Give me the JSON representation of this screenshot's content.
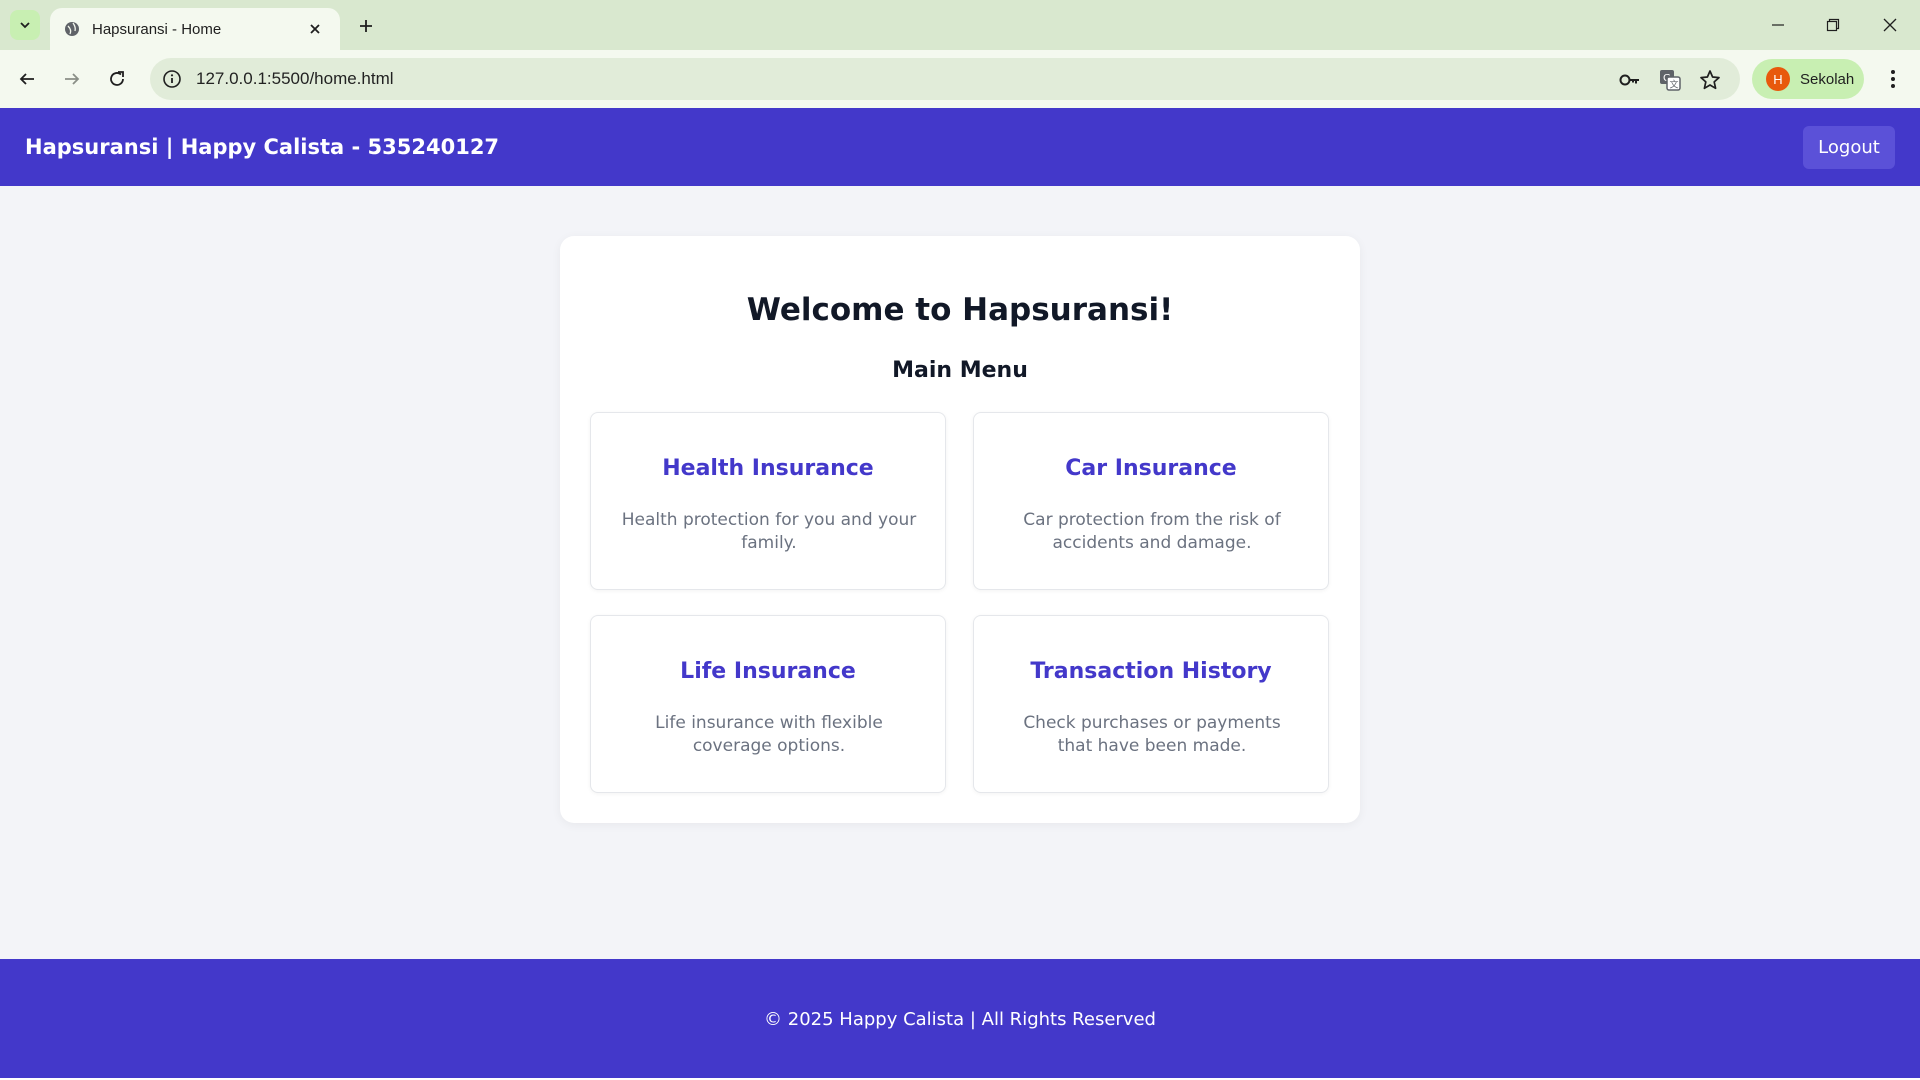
{
  "browser": {
    "tab_title": "Hapsuransi - Home",
    "url": "127.0.0.1:5500/home.html",
    "profile_initial": "H",
    "profile_name": "Sekolah",
    "icons": [
      "tab-list-icon",
      "globe-icon",
      "close-icon",
      "plus-icon",
      "minimize-icon",
      "restore-icon",
      "window-close-icon",
      "back-icon",
      "forward-icon",
      "reload-icon",
      "info-icon",
      "key-icon",
      "translate-icon",
      "star-icon",
      "kebab-menu-icon"
    ]
  },
  "header": {
    "brand": "Hapsuransi | Happy Calista - 535240127",
    "logout_label": "Logout"
  },
  "main": {
    "welcome": "Welcome to Hapsuransi!",
    "menu_title": "Main Menu",
    "items": [
      {
        "title": "Health Insurance",
        "description": "Health protection for you and your family."
      },
      {
        "title": "Car Insurance",
        "description": "Car protection from the risk of accidents and damage."
      },
      {
        "title": "Life Insurance",
        "description": "Life insurance with flexible coverage options."
      },
      {
        "title": "Transaction History",
        "description": "Check purchases or payments that have been made."
      }
    ]
  },
  "footer": {
    "text": "© 2025 Happy Calista | All Rights Reserved"
  },
  "colors": {
    "primary": "#4338ca",
    "button": "#5b51d8",
    "page_bg": "#f3f4f8",
    "tabbar_bg": "#d9e8cf",
    "toolbar_bg": "#f4f9ef"
  }
}
